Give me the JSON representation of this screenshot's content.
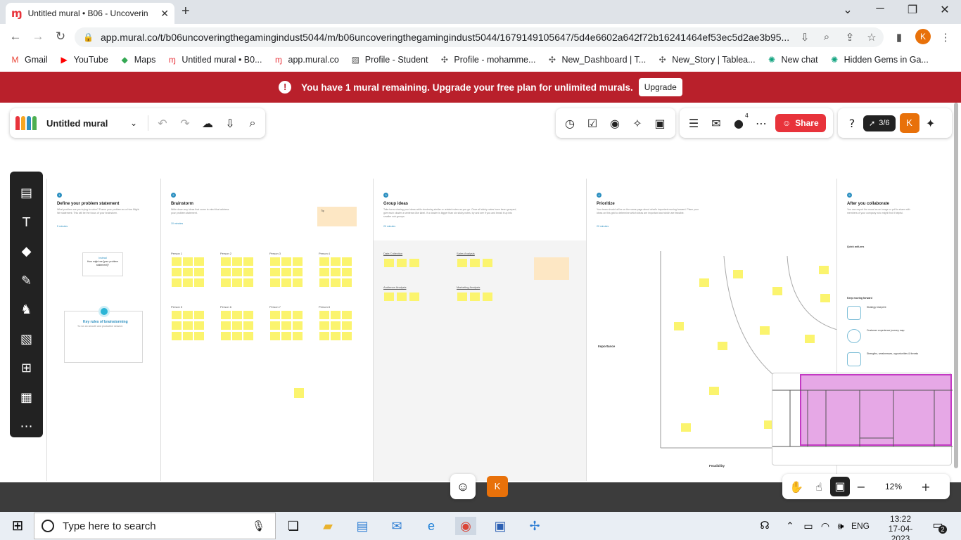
{
  "browser": {
    "tab_title": "Untitled mural • B06 - Uncoverin",
    "url": "app.mural.co/t/b06uncoveringthegamingindust5044/m/b06uncoveringthegamingindust5044/1679149105647/5d4e6602a642f72b16241464ef53ec5d2ae3b95...",
    "profile_initial": "K"
  },
  "bookmarks": [
    {
      "label": "Gmail",
      "icon": "gmail-icon",
      "color": "#ea4335",
      "glyph": "M"
    },
    {
      "label": "YouTube",
      "icon": "youtube-icon",
      "color": "#ff0000",
      "glyph": "▶"
    },
    {
      "label": "Maps",
      "icon": "maps-icon",
      "color": "#34a853",
      "glyph": "◆"
    },
    {
      "label": "Untitled mural • B0...",
      "icon": "mural-icon",
      "color": "#e8333b",
      "glyph": "ɱ"
    },
    {
      "label": "app.mural.co",
      "icon": "mural-icon",
      "color": "#e8333b",
      "glyph": "ɱ"
    },
    {
      "label": "Profile - Student",
      "icon": "profile-icon",
      "color": "#555555",
      "glyph": "▨"
    },
    {
      "label": "Profile - mohamme...",
      "icon": "tableau-icon",
      "color": "#555555",
      "glyph": "✣"
    },
    {
      "label": "New_Dashboard | T...",
      "icon": "tableau-icon",
      "color": "#555555",
      "glyph": "✣"
    },
    {
      "label": "New_Story | Tablea...",
      "icon": "tableau-icon",
      "color": "#555555",
      "glyph": "✣"
    },
    {
      "label": "New chat",
      "icon": "chatgpt-icon",
      "color": "#10a37f",
      "glyph": "✺"
    },
    {
      "label": "Hidden Gems in Ga...",
      "icon": "chatgpt-icon",
      "color": "#10a37f",
      "glyph": "✺"
    }
  ],
  "banner": {
    "message": "You have 1 mural remaining. Upgrade your free plan for unlimited murals.",
    "button": "Upgrade"
  },
  "mural": {
    "title": "Untitled mural",
    "share_label": "Share",
    "progress": "3/6",
    "collaborators_count": "4",
    "zoom": "12%",
    "user_initial": "K"
  },
  "panels": {
    "define": {
      "num": "1",
      "title": "Define your problem statement",
      "body": "What problem are you trying to solve? Frame your problem as a How Might We statement. This will be the focus of your brainstorm.",
      "time": "5 minutes",
      "card_head": "Instead",
      "card_text": "How might we [your problem statement]?",
      "rules_title": "Key rules of brainstorming",
      "rules_sub": "To run an smooth and productive session:"
    },
    "brainstorm": {
      "num": "2",
      "title": "Brainstorm",
      "body": "Write down any ideas that come to mind that address your problem statement.",
      "time": "10 minutes",
      "tip": "Tip",
      "persons": [
        "Person 1",
        "Person 2",
        "Person 3",
        "Person 4",
        "Person 5",
        "Person 6",
        "Person 7",
        "Person 8"
      ]
    },
    "group": {
      "num": "3",
      "title": "Group ideas",
      "body": "Take turns sharing your ideas while clustering similar or related notes as you go. Once all sticky notes have been grouped, give each cluster a sentence-like label. If a cluster is bigger than six sticky notes, try and see if you and break it up into smaller sub-groups.",
      "time": "20 minutes",
      "groups": [
        "Data Collection",
        "Sales Analysis",
        "Audience Analysis",
        "Marketing Analysis"
      ]
    },
    "prioritize": {
      "num": "4",
      "title": "Prioritize",
      "body": "Your team should all be on the same page about what's important moving forward. Place your ideas on this grid to determine which ideas are important and which are feasible.",
      "time": "20 minutes",
      "importance": "Importance",
      "feasibility": "Feasibility"
    },
    "after": {
      "num": "5",
      "title": "After you collaborate",
      "body": "You can export the mural as an image or pdf to share with members of your company who might find it helpful.",
      "quick": "Quick add-ons",
      "keep": "Keep moving forward",
      "items": [
        "Strategy blueprint",
        "Customer experience journey map",
        "Strengths, weaknesses, opportunities & threats"
      ]
    }
  },
  "taskbar": {
    "search_placeholder": "Type here to search",
    "time": "13:22",
    "date": "17-04-2023",
    "lang": "ENG",
    "notif": "2"
  }
}
